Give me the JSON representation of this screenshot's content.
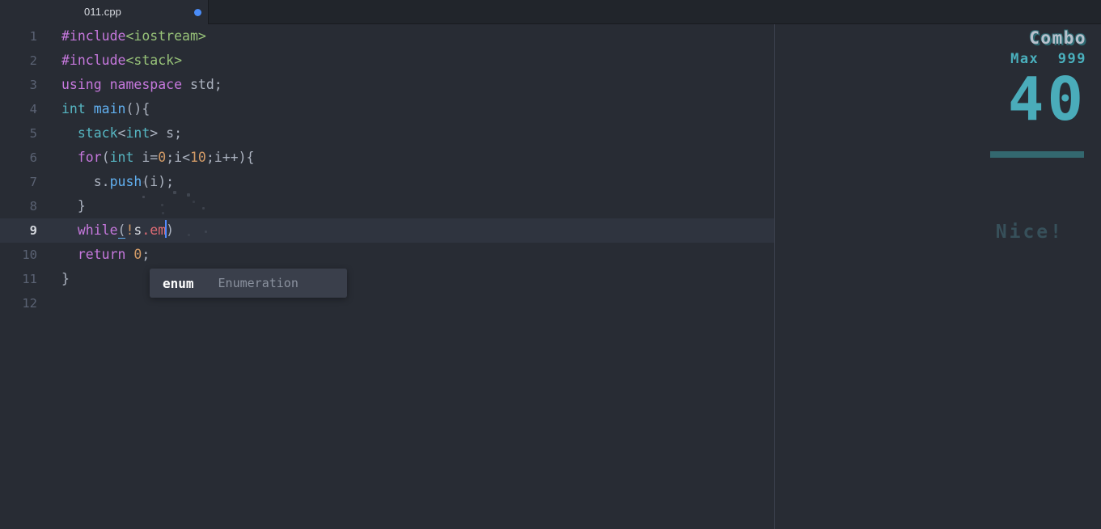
{
  "window": {
    "background_color": "#282c34",
    "accent_color": "#4aacba"
  },
  "tabbar": {
    "tabs": [
      {
        "label": "011.cpp",
        "modified": true,
        "active": true,
        "dot_color": "#4a8cf7"
      }
    ]
  },
  "editor": {
    "language": "cpp",
    "active_line": 9,
    "cursor": {
      "line": 9,
      "column": 15
    },
    "lines": [
      {
        "num": "1",
        "text": "#include<iostream>"
      },
      {
        "num": "2",
        "text": "#include<stack>"
      },
      {
        "num": "3",
        "text": "using namespace std;"
      },
      {
        "num": "4",
        "text": "int main(){"
      },
      {
        "num": "5",
        "text": "  stack<int> s;"
      },
      {
        "num": "6",
        "text": "  for(int i=0;i<10;i++){"
      },
      {
        "num": "7",
        "text": "    s.push(i);"
      },
      {
        "num": "8",
        "text": "  }"
      },
      {
        "num": "9",
        "text": "  while(!s.em)"
      },
      {
        "num": "10",
        "text": "  return 0;"
      },
      {
        "num": "11",
        "text": "}"
      },
      {
        "num": "12",
        "text": ""
      }
    ]
  },
  "autocomplete": {
    "visible": true,
    "items": [
      {
        "label": "enum",
        "detail": "Enumeration",
        "selected": true
      }
    ]
  },
  "combo": {
    "title": "Combo",
    "max_label": "Max",
    "max_value": "999",
    "count": "40",
    "progress_percent": 100,
    "praise_text": "Nice!",
    "bar_color": "#33686f",
    "number_color": "#4aacba"
  }
}
